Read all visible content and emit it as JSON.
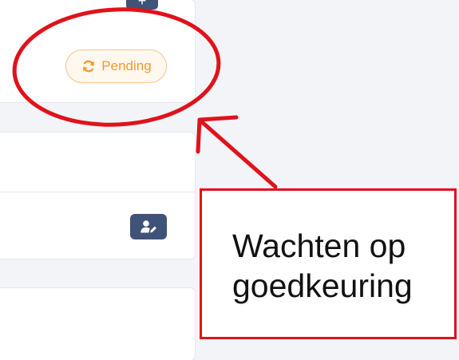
{
  "status_badge": {
    "label": "Pending",
    "icon": "refresh-icon",
    "color": "#f29a2c"
  },
  "toolbar": {
    "top_button_icon": "plus-icon",
    "top_button_glyph": "+",
    "edit_button_icon": "user-edit-icon"
  },
  "annotation": {
    "line1": "Wachten op",
    "line2": "goedkeuring",
    "color": "#e0121b"
  }
}
